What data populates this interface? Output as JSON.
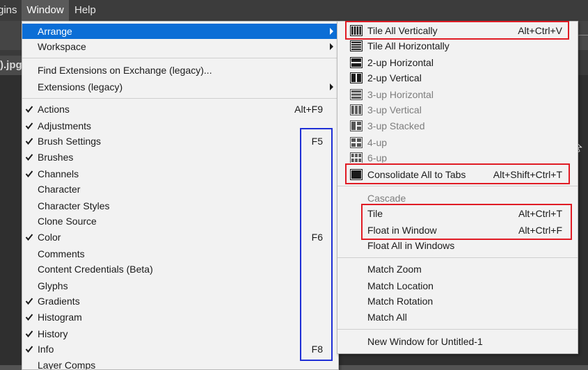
{
  "menubar": {
    "items": [
      {
        "label": "gins",
        "active": false
      },
      {
        "label": "Window",
        "active": true
      },
      {
        "label": "Help",
        "active": false
      }
    ]
  },
  "document": {
    "tab_label": ").jpg"
  },
  "window_menu": {
    "items": [
      {
        "label": "Arrange",
        "shortcut": "",
        "checked": false,
        "submenu": true,
        "highlighted": true
      },
      {
        "label": "Workspace",
        "shortcut": "",
        "checked": false,
        "submenu": true
      },
      {
        "label": "Find Extensions on Exchange (legacy)...",
        "shortcut": "",
        "checked": false,
        "submenu": false
      },
      {
        "label": "Extensions (legacy)",
        "shortcut": "",
        "checked": false,
        "submenu": true
      },
      {
        "label": "Actions",
        "shortcut": "Alt+F9",
        "checked": true,
        "submenu": false
      },
      {
        "label": "Adjustments",
        "shortcut": "",
        "checked": true,
        "submenu": false
      },
      {
        "label": "Brush Settings",
        "shortcut": "F5",
        "checked": true,
        "submenu": false
      },
      {
        "label": "Brushes",
        "shortcut": "",
        "checked": true,
        "submenu": false
      },
      {
        "label": "Channels",
        "shortcut": "",
        "checked": true,
        "submenu": false
      },
      {
        "label": "Character",
        "shortcut": "",
        "checked": false,
        "submenu": false
      },
      {
        "label": "Character Styles",
        "shortcut": "",
        "checked": false,
        "submenu": false
      },
      {
        "label": "Clone Source",
        "shortcut": "",
        "checked": false,
        "submenu": false
      },
      {
        "label": "Color",
        "shortcut": "F6",
        "checked": true,
        "submenu": false
      },
      {
        "label": "Comments",
        "shortcut": "",
        "checked": false,
        "submenu": false
      },
      {
        "label": "Content Credentials (Beta)",
        "shortcut": "",
        "checked": false,
        "submenu": false
      },
      {
        "label": "Glyphs",
        "shortcut": "",
        "checked": false,
        "submenu": false
      },
      {
        "label": "Gradients",
        "shortcut": "",
        "checked": true,
        "submenu": false
      },
      {
        "label": "Histogram",
        "shortcut": "",
        "checked": true,
        "submenu": false
      },
      {
        "label": "History",
        "shortcut": "",
        "checked": true,
        "submenu": false
      },
      {
        "label": "Info",
        "shortcut": "F8",
        "checked": true,
        "submenu": false
      },
      {
        "label": "Layer Comps",
        "shortcut": "",
        "checked": false,
        "submenu": false
      }
    ]
  },
  "arrange_menu": {
    "items": [
      {
        "label": "Tile All Vertically",
        "shortcut": "Alt+Ctrl+V",
        "icon": "tile-vertical-icon",
        "disabled": false
      },
      {
        "label": "Tile All Horizontally",
        "shortcut": "",
        "icon": "tile-horizontal-icon",
        "disabled": false
      },
      {
        "label": "2-up Horizontal",
        "shortcut": "",
        "icon": "two-up-horizontal-icon",
        "disabled": false
      },
      {
        "label": "2-up Vertical",
        "shortcut": "",
        "icon": "two-up-vertical-icon",
        "disabled": false
      },
      {
        "label": "3-up Horizontal",
        "shortcut": "",
        "icon": "three-up-horizontal-icon",
        "disabled": true
      },
      {
        "label": "3-up Vertical",
        "shortcut": "",
        "icon": "three-up-vertical-icon",
        "disabled": true
      },
      {
        "label": "3-up Stacked",
        "shortcut": "",
        "icon": "three-up-stacked-icon",
        "disabled": true
      },
      {
        "label": "4-up",
        "shortcut": "",
        "icon": "four-up-icon",
        "disabled": true
      },
      {
        "label": "6-up",
        "shortcut": "",
        "icon": "six-up-icon",
        "disabled": true
      },
      {
        "label": "Consolidate All to Tabs",
        "shortcut": "Alt+Shift+Ctrl+T",
        "icon": "consolidate-icon",
        "disabled": false
      },
      {
        "label": "Cascade",
        "shortcut": "",
        "disabled": true
      },
      {
        "label": "Tile",
        "shortcut": "Alt+Ctrl+T",
        "disabled": false
      },
      {
        "label": "Float in Window",
        "shortcut": "Alt+Ctrl+F",
        "disabled": false
      },
      {
        "label": "Float All in Windows",
        "shortcut": "",
        "disabled": false
      },
      {
        "label": "Match Zoom",
        "shortcut": "",
        "disabled": false
      },
      {
        "label": "Match Location",
        "shortcut": "",
        "disabled": false
      },
      {
        "label": "Match Rotation",
        "shortcut": "",
        "disabled": false
      },
      {
        "label": "Match All",
        "shortcut": "",
        "disabled": false
      },
      {
        "label": "New Window for Untitled-1",
        "shortcut": "",
        "disabled": false
      }
    ]
  },
  "colors": {
    "highlight": "#0b6ed6",
    "red_annotation": "#e01b24",
    "blue_annotation": "#1f2fd6",
    "menu_bg": "#f2f2f2",
    "disabled_text": "#7d7d7d"
  }
}
